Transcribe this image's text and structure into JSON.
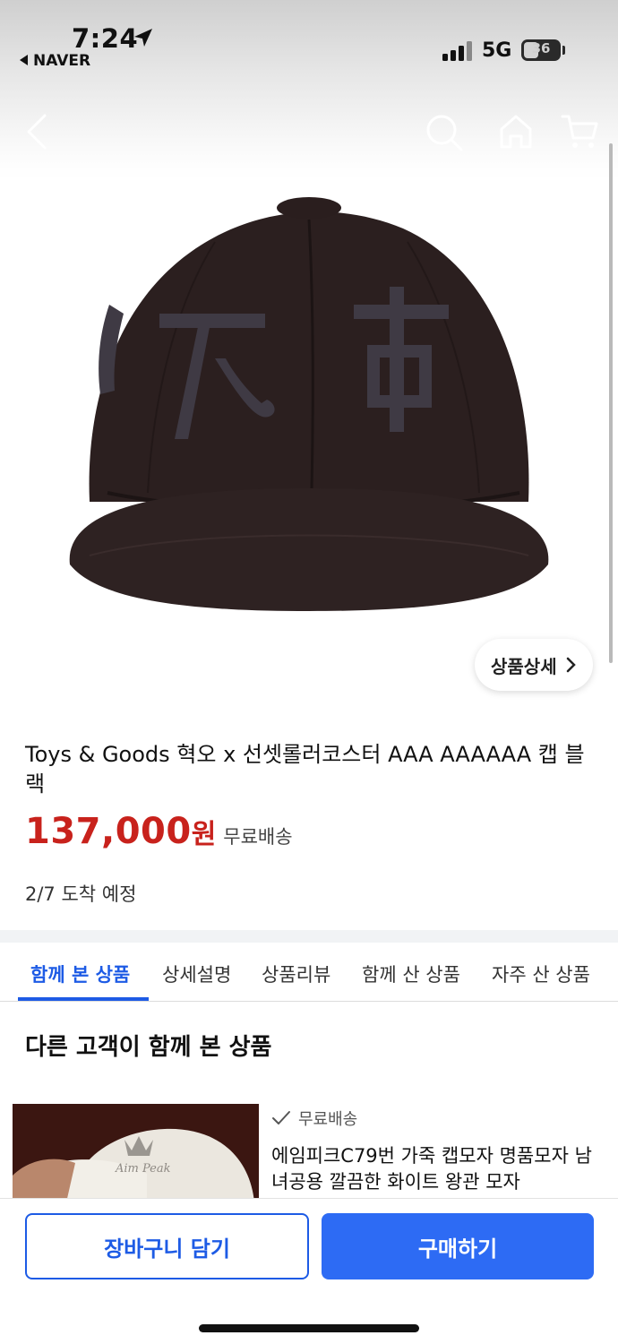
{
  "status_bar": {
    "time": "7:24",
    "back_app": "NAVER",
    "network": "5G",
    "battery": "36"
  },
  "nav": {
    "icons": [
      "back-icon",
      "search-icon",
      "home-icon",
      "cart-icon"
    ]
  },
  "product": {
    "detail_button": "상품상세",
    "title": "Toys & Goods 혁오 x 선셋롤러코스터 AAA AAAAAA 캡 블랙",
    "price": "137,000",
    "currency": "원",
    "shipping": "무료배송",
    "eta": "2/7 도착 예정"
  },
  "tabs": [
    {
      "label": "함께 본 상품",
      "active": true
    },
    {
      "label": "상세설명",
      "active": false
    },
    {
      "label": "상품리뷰",
      "active": false
    },
    {
      "label": "함께 산 상품",
      "active": false
    },
    {
      "label": "자주 산 상품",
      "active": false
    }
  ],
  "section": {
    "title": "다른 고객이 함께 본 상품"
  },
  "recommendation": {
    "shipping": "무료배송",
    "name": "에임피크C79번 가죽 캡모자 명품모자 남녀공용 깔끔한 화이트 왕관 모자"
  },
  "actions": {
    "cart": "장바구니 담기",
    "buy": "구매하기"
  },
  "colors": {
    "accent": "#1d5be5",
    "price": "#c8221c",
    "buy_button": "#2d6bf4"
  }
}
